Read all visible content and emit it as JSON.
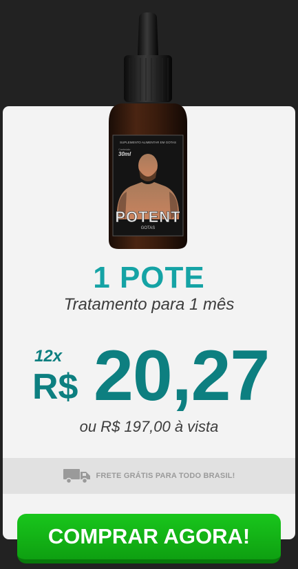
{
  "product": {
    "bottle_label_small": "SUPLEMENTO ALIMENTAR EM GOTAS",
    "bottle_volume_prefix": "Conteúdo",
    "bottle_volume": "30ml",
    "bottle_brand": "POTENT",
    "bottle_sub": "GOTAS"
  },
  "offer": {
    "title": "1 POTE",
    "subtitle": "Tratamento para 1 mês",
    "installments": "12x",
    "currency": "R$",
    "amount": "20,27",
    "cash_price": "ou R$ 197,00 à vista"
  },
  "shipping": {
    "text": "FRETE GRÁTIS PARA TODO BRASIL!",
    "icon": "truck-icon"
  },
  "cta": {
    "label": "COMPRAR AGORA!"
  },
  "colors": {
    "background": "#222222",
    "card": "#f3f3f3",
    "title": "#15a3a5",
    "price": "#0d7f80",
    "cta": "#12b515"
  }
}
